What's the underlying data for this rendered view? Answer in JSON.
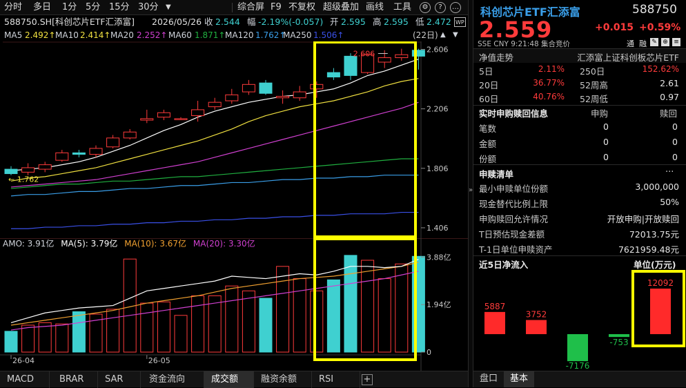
{
  "toolbar": {
    "tabs": [
      "分时",
      "多日",
      "1分",
      "5分",
      "15分",
      "30分"
    ],
    "right_items": [
      "综合屏",
      "F9",
      "不复权",
      "超级叠加",
      "画线",
      "工具"
    ]
  },
  "info": {
    "code_name": "588750.SH[科创芯片ETF汇添富]",
    "date": "2026/05/26",
    "close_label": "收",
    "close": "2.544",
    "change_label": "幅",
    "change": "-2.19%(-0.057)",
    "open_label": "开",
    "open": "2.595",
    "high_label": "高",
    "high": "2.595",
    "low_label": "低",
    "low": "2.472",
    "badge": "WP"
  },
  "ma_row": {
    "ma5_label": "MA5",
    "ma5": "2.492↑",
    "ma10_label": "MA10",
    "ma10": "2.414↑",
    "ma20_label": "MA20",
    "ma20": "2.252↑",
    "ma60_label": "MA60",
    "ma60": "1.871↑",
    "ma120_label": "MA120",
    "ma120": "1.762↑",
    "ma250_label": "MA250",
    "ma250": "1.506↑",
    "period": "(22日)"
  },
  "colors": {
    "up": "#ff3b3b",
    "down": "#3fd0d0",
    "ma5": "#ffffff",
    "ma10": "#f0e040",
    "ma20": "#d040d0",
    "ma60": "#20b040",
    "ma120": "#3a9ee8",
    "ma250": "#3a50e8",
    "highlight": "#ffff00"
  },
  "price_axis": [
    "2.606",
    "2.206",
    "1.806",
    "1.406"
  ],
  "annotations": {
    "high_marker": "2.606",
    "low_marker": "1.762"
  },
  "volume": {
    "header": {
      "amo_label": "AMO:",
      "amo": "3.91亿",
      "ma5_label": "MA(5):",
      "ma5": "3.79亿",
      "ma10_label": "MA(10):",
      "ma10": "3.67亿",
      "ma20_label": "MA(20):",
      "ma20": "3.30亿"
    },
    "axis": [
      "3.88亿",
      "1.94亿",
      "0"
    ],
    "x_labels": [
      "26-04",
      "26-05"
    ]
  },
  "chart_data": {
    "type": "candlestick",
    "ylim": [
      1.35,
      2.65
    ],
    "candles": [
      {
        "o": 1.8,
        "c": 1.77,
        "h": 1.82,
        "l": 1.76,
        "v": 0.85
      },
      {
        "o": 1.78,
        "c": 1.81,
        "h": 1.84,
        "l": 1.76,
        "v": 1.1
      },
      {
        "o": 1.8,
        "c": 1.83,
        "h": 1.85,
        "l": 1.78,
        "v": 1.2
      },
      {
        "o": 1.86,
        "c": 1.91,
        "h": 1.93,
        "l": 1.85,
        "v": 1.15
      },
      {
        "o": 1.91,
        "c": 1.9,
        "h": 1.93,
        "l": 1.88,
        "v": 1.65
      },
      {
        "o": 1.9,
        "c": 1.94,
        "h": 1.96,
        "l": 1.88,
        "v": 1.55
      },
      {
        "o": 1.95,
        "c": 2.01,
        "h": 2.03,
        "l": 1.94,
        "v": 1.75
      },
      {
        "o": 2.01,
        "c": 2.05,
        "h": 2.07,
        "l": 2.0,
        "v": 3.8
      },
      {
        "o": 2.13,
        "c": 2.14,
        "h": 2.2,
        "l": 2.11,
        "v": 2.0
      },
      {
        "o": 2.15,
        "c": 2.18,
        "h": 2.2,
        "l": 2.13,
        "v": 2.05
      },
      {
        "o": 2.14,
        "c": 2.14,
        "h": 2.15,
        "l": 2.13,
        "v": 1.5
      },
      {
        "o": 2.16,
        "c": 2.2,
        "h": 2.26,
        "l": 2.12,
        "v": 2.3
      },
      {
        "o": 2.22,
        "c": 2.25,
        "h": 2.28,
        "l": 2.2,
        "v": 2.3
      },
      {
        "o": 2.26,
        "c": 2.3,
        "h": 2.34,
        "l": 2.24,
        "v": 2.7
      },
      {
        "o": 2.32,
        "c": 2.37,
        "h": 2.4,
        "l": 2.3,
        "v": 2.5
      },
      {
        "o": 2.38,
        "c": 2.31,
        "h": 2.4,
        "l": 2.3,
        "v": 2.2
      },
      {
        "o": 2.28,
        "c": 2.29,
        "h": 2.33,
        "l": 2.24,
        "v": 3.5
      },
      {
        "o": 2.28,
        "c": 2.32,
        "h": 2.36,
        "l": 2.26,
        "v": 3.0
      },
      {
        "o": 2.34,
        "c": 2.37,
        "h": 2.39,
        "l": 2.28,
        "v": 2.5
      },
      {
        "o": 2.45,
        "c": 2.42,
        "h": 2.48,
        "l": 2.4,
        "v": 2.95
      },
      {
        "o": 2.56,
        "c": 2.43,
        "h": 2.58,
        "l": 2.4,
        "v": 3.95
      },
      {
        "o": 2.45,
        "c": 2.57,
        "h": 2.58,
        "l": 2.44,
        "v": 3.75
      },
      {
        "o": 2.52,
        "c": 2.55,
        "h": 2.6,
        "l": 2.48,
        "v": 3.0
      },
      {
        "o": 2.55,
        "c": 2.57,
        "h": 2.61,
        "l": 2.53,
        "v": 3.6
      },
      {
        "o": 2.6,
        "c": 2.56,
        "h": 2.61,
        "l": 2.47,
        "v": 3.91
      }
    ],
    "ma5": [
      1.79,
      1.8,
      1.81,
      1.83,
      1.85,
      1.88,
      1.92,
      1.96,
      2.01,
      2.06,
      2.1,
      2.15,
      2.19,
      2.22,
      2.25,
      2.27,
      2.29,
      2.3,
      2.32,
      2.34,
      2.38,
      2.43,
      2.46,
      2.5,
      2.54
    ],
    "ma10": [
      1.72,
      1.74,
      1.75,
      1.77,
      1.79,
      1.81,
      1.84,
      1.87,
      1.9,
      1.93,
      1.96,
      1.99,
      2.03,
      2.07,
      2.12,
      2.16,
      2.19,
      2.22,
      2.24,
      2.26,
      2.29,
      2.32,
      2.36,
      2.39,
      2.41
    ],
    "ma20": [
      1.68,
      1.69,
      1.7,
      1.71,
      1.72,
      1.73,
      1.75,
      1.77,
      1.79,
      1.81,
      1.83,
      1.85,
      1.88,
      1.91,
      1.94,
      1.97,
      2.0,
      2.03,
      2.06,
      2.09,
      2.12,
      2.15,
      2.18,
      2.21,
      2.25
    ],
    "ma60": [
      1.67,
      1.68,
      1.69,
      1.7,
      1.7,
      1.71,
      1.72,
      1.72,
      1.73,
      1.74,
      1.75,
      1.75,
      1.76,
      1.77,
      1.78,
      1.79,
      1.8,
      1.81,
      1.82,
      1.83,
      1.84,
      1.85,
      1.86,
      1.87,
      1.87
    ],
    "ma120": [
      1.62,
      1.63,
      1.63,
      1.64,
      1.65,
      1.65,
      1.66,
      1.67,
      1.67,
      1.68,
      1.69,
      1.69,
      1.7,
      1.71,
      1.71,
      1.72,
      1.73,
      1.73,
      1.74,
      1.74,
      1.75,
      1.75,
      1.76,
      1.76,
      1.76
    ],
    "ma250": [
      1.4,
      1.4,
      1.41,
      1.41,
      1.42,
      1.42,
      1.43,
      1.43,
      1.44,
      1.44,
      1.45,
      1.45,
      1.46,
      1.46,
      1.47,
      1.47,
      1.48,
      1.48,
      1.49,
      1.49,
      1.5,
      1.5,
      1.5,
      1.51,
      1.51
    ],
    "vol_ylim": [
      0,
      4.2
    ],
    "vol_ma5": [
      1.2,
      1.4,
      1.6,
      1.7,
      1.8,
      1.85,
      1.9,
      2.2,
      2.5,
      2.6,
      2.7,
      2.8,
      2.9,
      3.1,
      3.05,
      3.0,
      3.1,
      3.2,
      3.15,
      3.3,
      3.5,
      3.5,
      3.45,
      3.5,
      3.79
    ],
    "vol_ma10": [
      1.1,
      1.2,
      1.3,
      1.4,
      1.5,
      1.6,
      1.7,
      1.85,
      2.0,
      2.1,
      2.2,
      2.3,
      2.45,
      2.6,
      2.7,
      2.8,
      2.9,
      3.0,
      3.05,
      3.1,
      3.2,
      3.3,
      3.4,
      3.5,
      3.67
    ],
    "vol_ma20": [
      0.9,
      1.0,
      1.05,
      1.1,
      1.2,
      1.3,
      1.4,
      1.5,
      1.6,
      1.7,
      1.8,
      1.9,
      2.0,
      2.1,
      2.2,
      2.3,
      2.4,
      2.5,
      2.6,
      2.7,
      2.8,
      2.9,
      3.0,
      3.15,
      3.3
    ]
  },
  "quote": {
    "name": "科创芯片ETF汇添富",
    "code": "588750",
    "price": "2.559",
    "change": "+0.015",
    "change_pct": "+0.59%",
    "currency_line": "SSE  CNY  9:21:48  集合竞价",
    "tags": [
      "通",
      "融"
    ]
  },
  "nav": {
    "title": "净值走势",
    "fund_name": "汇添富上证科创板芯片ETF",
    "rows": [
      {
        "l1": "5日",
        "v1": "2.11%",
        "l2": "250日",
        "v2": "152.62%",
        "c2": "red"
      },
      {
        "l1": "20日",
        "v1": "36.77%",
        "l2": "52周高",
        "v2": "2.61",
        "c2": "plain"
      },
      {
        "l1": "60日",
        "v1": "40.76%",
        "l2": "52周低",
        "v2": "0.97",
        "c2": "plain"
      }
    ]
  },
  "realtime": {
    "title": "实时申购赎回信息",
    "col1": "申购",
    "col2": "赎回",
    "rows": [
      {
        "label": "笔数",
        "buy": "0",
        "sell": "0"
      },
      {
        "label": "金额",
        "buy": "0",
        "sell": "0"
      },
      {
        "label": "份额",
        "buy": "0",
        "sell": "0"
      }
    ]
  },
  "redemption": {
    "title": "申赎清单",
    "more": "...",
    "rows": [
      {
        "label": "最小申赎单位份额",
        "value": "3,000,000"
      },
      {
        "label": "现金替代比例上限",
        "value": "50%"
      },
      {
        "label": "申购赎回允许情况",
        "value": "开放申购|开放赎回"
      },
      {
        "label": "T日预估现金差额",
        "value": "72013.75元"
      },
      {
        "label": "T-1日单位申赎资产",
        "value": "7621959.48元"
      }
    ]
  },
  "net_inflow": {
    "title": "近5日净流入",
    "unit": "单位(万元)",
    "values": [
      5887,
      3752,
      -7176,
      -753,
      12092
    ],
    "labels": [
      "5887",
      "3752",
      "-7176",
      "-753",
      "12092"
    ]
  },
  "right_tabs": [
    "盘口",
    "基本"
  ]
}
